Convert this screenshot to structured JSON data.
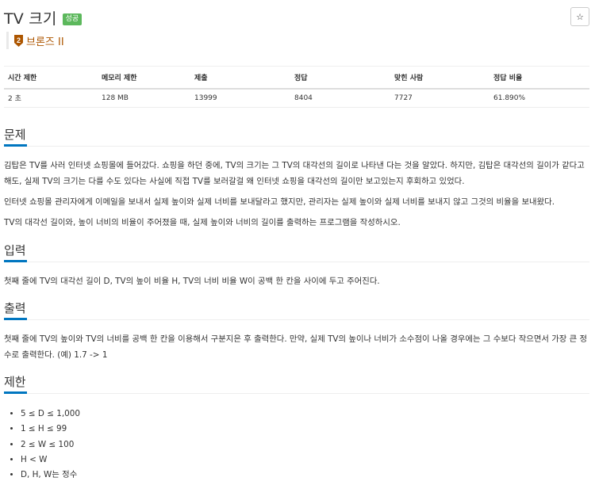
{
  "problem": {
    "title": "TV 크기",
    "badge": "성공",
    "star_icon": "☆",
    "tier": {
      "label": "브론즈 II",
      "icon": "bronze-tier-icon",
      "level": "2",
      "color": "#ad5600"
    }
  },
  "stats": {
    "headers": [
      "시간 제한",
      "메모리 제한",
      "제출",
      "정답",
      "맞힌 사람",
      "정답 비율"
    ],
    "values": [
      "2 초",
      "128 MB",
      "13999",
      "8404",
      "7727",
      "61.890%"
    ]
  },
  "sections": {
    "problem": {
      "title": "문제",
      "paragraphs": [
        "김탑은 TV를 사러 인터넷 쇼핑몰에 들어갔다. 쇼핑을 하던 중에, TV의 크기는 그 TV의 대각선의 길이로 나타낸 다는 것을 알았다. 하지만, 김탑은 대각선의 길이가 같다고 해도, 실제 TV의 크기는 다를 수도 있다는 사실에 직접 TV를 보러갈걸 왜 인터넷 쇼핑을 대각선의 길이만 보고있는지 후회하고 있었다.",
        "인터넷 쇼핑몰 관리자에게 이메일을 보내서 실제 높이와 실제 너비를 보내달라고 했지만, 관리자는 실제 높이와 실제 너비를 보내지 않고 그것의 비율을 보내왔다.",
        "TV의 대각선 길이와, 높이 너비의 비율이 주어졌을 때, 실제 높이와 너비의 길이를 출력하는 프로그램을 작성하시오."
      ]
    },
    "input": {
      "title": "입력",
      "text": "첫째 줄에 TV의 대각선 길이 D, TV의 높이 비율 H, TV의 너비 비율 W이 공백 한 칸을 사이에 두고 주어진다."
    },
    "output": {
      "title": "출력",
      "text": "첫째 줄에 TV의 높이와 TV의 너비를 공백 한 칸을 이용해서 구분지은 후 출력한다. 만약, 실제 TV의 높이나 너비가 소수점이 나올 경우에는 그 수보다 작으면서 가장 큰 정수로 출력한다. (예) 1.7 -> 1"
    },
    "limits": {
      "title": "제한",
      "items": [
        "5 ≤ D ≤ 1,000",
        "1 ≤ H ≤ 99",
        "2 ≤ W ≤ 100",
        "H < W",
        "D, H, W는 정수"
      ]
    }
  },
  "colors": {
    "accent": "#0076c0",
    "success": "#5cb85c",
    "bronze": "#ad5600"
  }
}
